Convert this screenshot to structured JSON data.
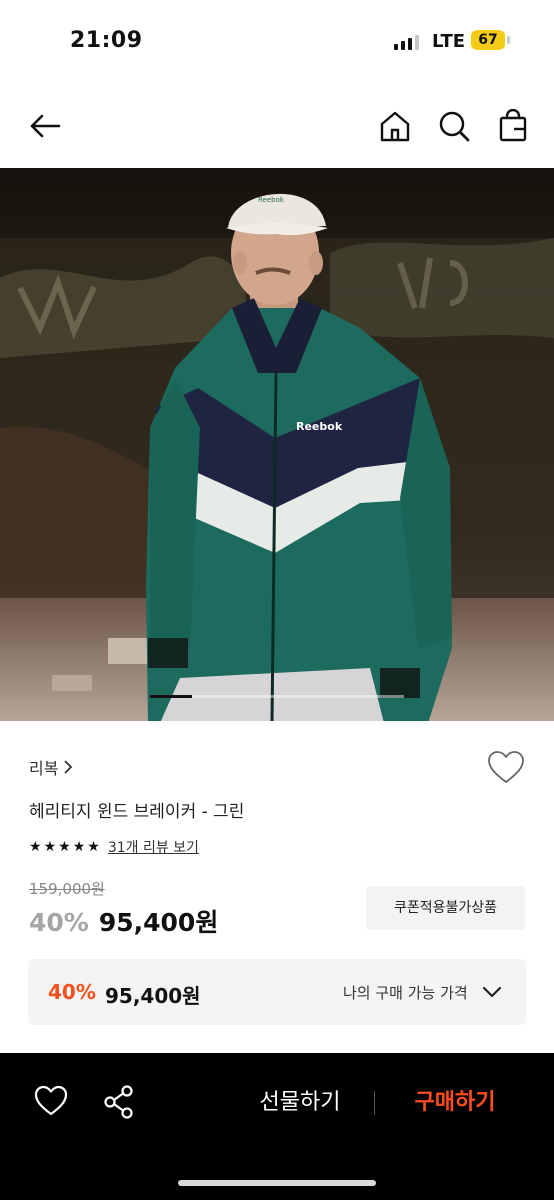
{
  "status_bar": {
    "time": "21:09",
    "network": "LTE",
    "battery": "67"
  },
  "brand": {
    "name": "리복"
  },
  "product": {
    "name": "헤리티지 윈드 브레이커 - 그린",
    "rating_stars": 5,
    "review_link": "31개 리뷰 보기",
    "original_price": "159,000원",
    "discount": "40%",
    "sale_price": "95,400원",
    "coupon_badge": "쿠폰적용불가상품",
    "image": {
      "logo_text": "Reebok"
    }
  },
  "my_price": {
    "discount": "40%",
    "price": "95,400원",
    "label": "나의 구매 가능 가격"
  },
  "bottom_bar": {
    "gift_label": "선물하기",
    "buy_label": "구매하기"
  },
  "icons": {
    "back": "arrow-left-icon",
    "home": "home-icon",
    "search": "search-icon",
    "bag": "shopping-bag-icon",
    "wish": "heart-outline-icon",
    "share": "share-icon",
    "expand": "chevron-down-icon"
  },
  "colors": {
    "accent": "#ff4c1f",
    "discount_gray": "#a5a5a5",
    "battery": "#f4cc17",
    "jacket_green": "#1d6a5e",
    "jacket_navy": "#1e2442"
  },
  "image_pager": {
    "current": 1,
    "total": 6
  }
}
